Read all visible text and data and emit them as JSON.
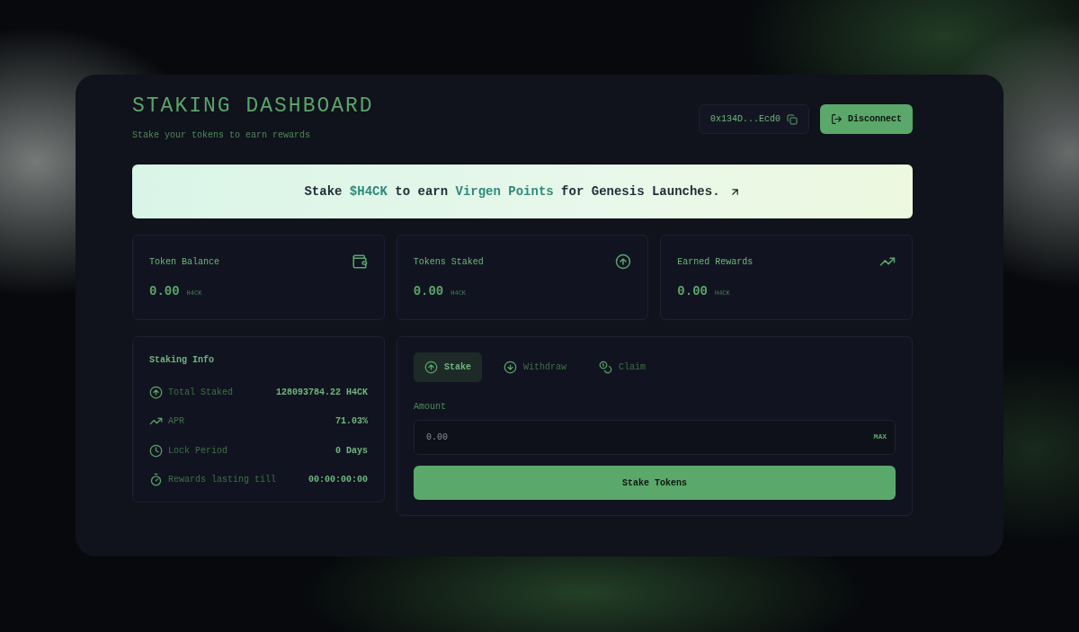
{
  "header": {
    "title": "STAKING DASHBOARD",
    "subtitle": "Stake your tokens to earn rewards",
    "address": "0x134D...Ecd0",
    "disconnect": "Disconnect"
  },
  "banner": {
    "text": "Stake **$H4CK** to earn **Virgen Points** for Genesis Launches."
  },
  "stats": [
    {
      "label": "Token Balance",
      "value": "0.00",
      "unit": "H4CK"
    },
    {
      "label": "Tokens Staked",
      "value": "0.00",
      "unit": "H4CK"
    },
    {
      "label": "Earned Rewards",
      "value": "0.00",
      "unit": "H4CK"
    }
  ],
  "staking_info": {
    "title": "Staking Info",
    "rows": [
      {
        "label": "Total Staked",
        "value": "128093784.22 H4CK"
      },
      {
        "label": "APR",
        "value": "71.03%"
      },
      {
        "label": "Lock Period",
        "value": "0 Days"
      },
      {
        "label": "Rewards lasting till",
        "value": "00:00:00:00"
      }
    ]
  },
  "action_panel": {
    "tabs": [
      {
        "label": "Stake",
        "selected": true
      },
      {
        "label": "Withdraw",
        "selected": false
      },
      {
        "label": "Claim",
        "selected": false
      }
    ],
    "amount_label": "Amount",
    "amount_placeholder": "0.00",
    "max": "MAX",
    "submit": "Stake Tokens"
  }
}
